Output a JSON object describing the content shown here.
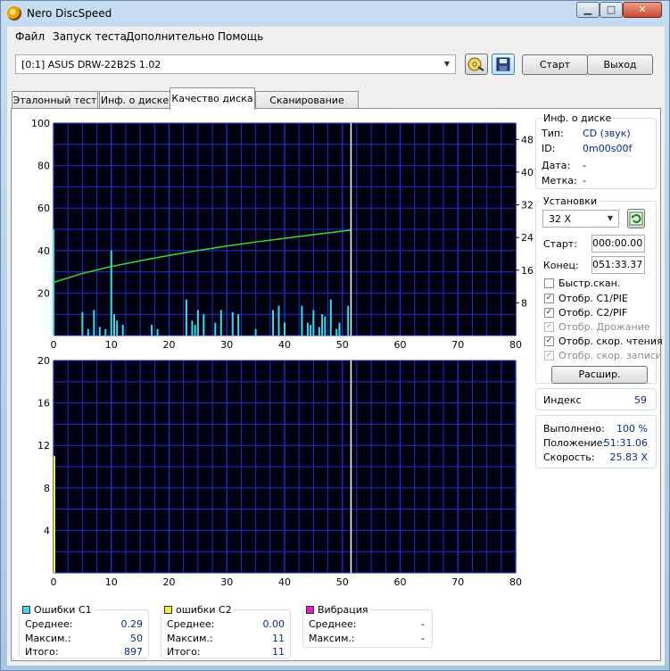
{
  "window": {
    "title": "Nero DiscSpeed",
    "min": "▁",
    "max": "□",
    "close": "✕"
  },
  "menu": [
    "Файл",
    "Запуск теста",
    "Дополнительно",
    "Помощь"
  ],
  "toolbar": {
    "drive": "[0:1]   ASUS DRW-22B2S 1.02",
    "start": "Старт",
    "exit": "Выход"
  },
  "tabs": [
    "Эталонный тест",
    "Инф. о диске",
    "Качество диска",
    "Сканирование диска"
  ],
  "active_tab": 2,
  "disc_info": {
    "title": "Инф. о диске",
    "rows": [
      {
        "label": "Тип:",
        "value": "CD (звук)"
      },
      {
        "label": "ID:",
        "value": "0m00s00f"
      },
      {
        "label": "Дата:",
        "value": "-"
      },
      {
        "label": "Метка:",
        "value": "-"
      }
    ]
  },
  "settings": {
    "title": "Установки",
    "speed": "32 X",
    "start_label": "Старт:",
    "start_value": "000:00.00",
    "end_label": "Конец:",
    "end_value": "051:33.37",
    "checks": [
      {
        "label": "Быстр.скан.",
        "checked": false,
        "disabled": false
      },
      {
        "label": "Отобр. C1/PIE",
        "checked": true,
        "disabled": false
      },
      {
        "label": "Отобр. C2/PIF",
        "checked": true,
        "disabled": false
      },
      {
        "label": "Отобр. Дрожание",
        "checked": true,
        "disabled": true
      },
      {
        "label": "Отобр. скор. чтения",
        "checked": true,
        "disabled": false
      },
      {
        "label": "Отобр. скор. записи",
        "checked": true,
        "disabled": true
      }
    ],
    "advanced": "Расшир."
  },
  "index": {
    "label": "Индекс",
    "value": "59"
  },
  "progress": {
    "rows": [
      {
        "label": "Выполнено:",
        "value": "100 %"
      },
      {
        "label": "Положение:",
        "value": "51:31.06"
      },
      {
        "label": "Скорость:",
        "value": "25.83 X"
      }
    ]
  },
  "stats": [
    {
      "title": "Ошибки C1",
      "color": "#40d8e8",
      "rows": [
        {
          "label": "Среднее:",
          "value": "0.29"
        },
        {
          "label": "Максим.:",
          "value": "50"
        },
        {
          "label": "Итого:",
          "value": "897"
        }
      ]
    },
    {
      "title": "ошибки C2",
      "color": "#f0f040",
      "rows": [
        {
          "label": "Среднее:",
          "value": "0.00"
        },
        {
          "label": "Максим.:",
          "value": "11"
        },
        {
          "label": "Итого:",
          "value": "11"
        }
      ]
    },
    {
      "title": "Вибрация",
      "color": "#e020d0",
      "rows": [
        {
          "label": "Среднее:",
          "value": "-"
        },
        {
          "label": "Максим.:",
          "value": "-"
        }
      ]
    }
  ],
  "colors": {
    "plot_bg": "#000010",
    "grid": "#1f2fc8",
    "c1_bar": "#30e0f0",
    "c2_bar": "#f0f030",
    "speed_line": "#30e030",
    "position_marker": "#ffffff"
  },
  "chart_data": [
    {
      "type": "bar",
      "name": "c1-chart",
      "x_range": [
        0,
        80
      ],
      "y_left_range": [
        0,
        100
      ],
      "y_right_range": [
        0,
        52
      ],
      "x_ticks": [
        "0",
        "10",
        "20",
        "30",
        "40",
        "50",
        "60",
        "70",
        "80"
      ],
      "y_left_ticks": [
        "20",
        "40",
        "60",
        "80",
        "100"
      ],
      "y_right_ticks": [
        "8",
        "16",
        "24",
        "32",
        "40",
        "48"
      ],
      "position_marker": 51.5,
      "series": [
        {
          "name": "C1",
          "points": [
            [
              0,
              50
            ],
            [
              5,
              11
            ],
            [
              6,
              3
            ],
            [
              7,
              12
            ],
            [
              8,
              4
            ],
            [
              9,
              3
            ],
            [
              10,
              40
            ],
            [
              10.5,
              10
            ],
            [
              11,
              7
            ],
            [
              12,
              5
            ],
            [
              17,
              5
            ],
            [
              18,
              3
            ],
            [
              23,
              17
            ],
            [
              24,
              7
            ],
            [
              24.5,
              5
            ],
            [
              25,
              12
            ],
            [
              26,
              10
            ],
            [
              28,
              6
            ],
            [
              29,
              12
            ],
            [
              31,
              11
            ],
            [
              32,
              10
            ],
            [
              35,
              3
            ],
            [
              38,
              12
            ],
            [
              39,
              14
            ],
            [
              40,
              6
            ],
            [
              43,
              14
            ],
            [
              44,
              6
            ],
            [
              44.5,
              5
            ],
            [
              45,
              12
            ],
            [
              46,
              4
            ],
            [
              46.5,
              10
            ],
            [
              47,
              9
            ],
            [
              48,
              17
            ],
            [
              49,
              3
            ],
            [
              49.5,
              6
            ],
            [
              51,
              14
            ]
          ]
        },
        {
          "name": "Speed",
          "points": [
            [
              0,
              13
            ],
            [
              5,
              15.2
            ],
            [
              10,
              16.9
            ],
            [
              15,
              18.3
            ],
            [
              20,
              19.6
            ],
            [
              25,
              20.8
            ],
            [
              30,
              21.9
            ],
            [
              35,
              22.9
            ],
            [
              40,
              23.8
            ],
            [
              45,
              24.7
            ],
            [
              51.5,
              25.8
            ]
          ]
        }
      ]
    },
    {
      "type": "bar",
      "name": "c2-chart",
      "x_range": [
        0,
        80
      ],
      "y_range": [
        0,
        20
      ],
      "x_ticks": [
        "0",
        "10",
        "20",
        "30",
        "40",
        "50",
        "60",
        "70",
        "80"
      ],
      "y_ticks": [
        "4",
        "8",
        "12",
        "16",
        "20"
      ],
      "position_marker": 51.5,
      "series": [
        {
          "name": "C2",
          "points": [
            [
              0,
              11
            ]
          ]
        }
      ]
    }
  ]
}
